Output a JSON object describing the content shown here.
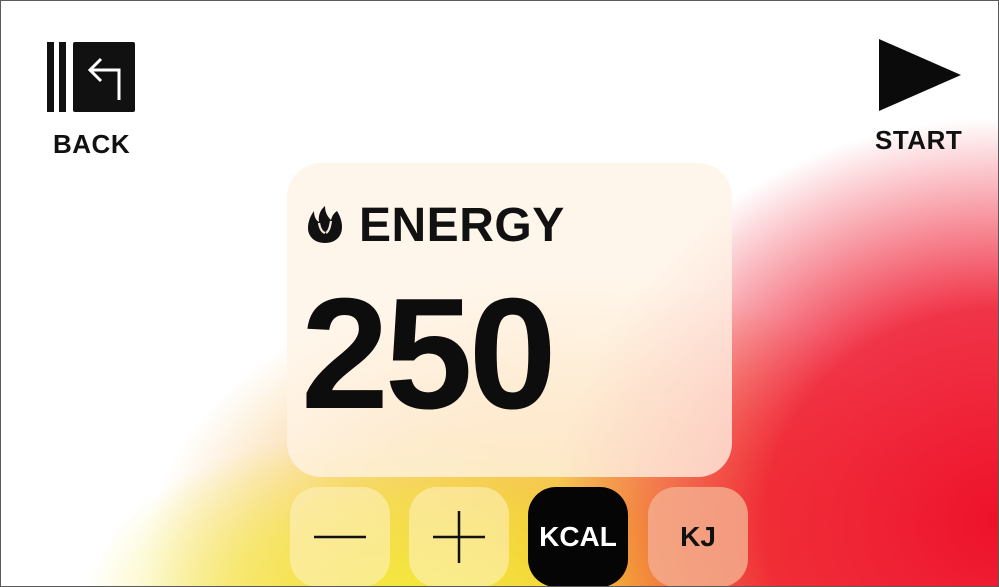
{
  "toolbar": {
    "back": {
      "label": "BACK",
      "icon": "back-exit-icon"
    },
    "start": {
      "label": "START",
      "icon": "play-icon"
    }
  },
  "energy": {
    "title": "ENERGY",
    "icon": "flame-icon",
    "value": "250"
  },
  "controls": {
    "decrement_icon": "minus-icon",
    "increment_icon": "plus-icon",
    "units": [
      {
        "label": "KCAL",
        "selected": true
      },
      {
        "label": "KJ",
        "selected": false
      }
    ]
  },
  "colors": {
    "background_red": "#ee1128",
    "background_yellow": "#f3e93a",
    "background_orange": "#f4a62c",
    "selected_unit": "#050505",
    "unselected_unit": "#f4aa8c"
  }
}
